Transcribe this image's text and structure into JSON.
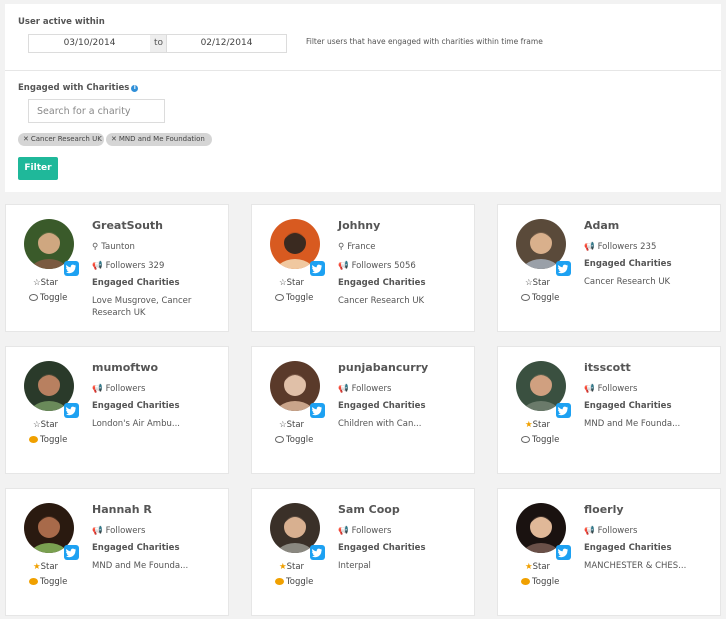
{
  "filters": {
    "active_label": "User active within",
    "date_from": "03/10/2014",
    "to_label": "to",
    "date_to": "02/12/2014",
    "help_text": "Filter users that have engaged with charities within time frame",
    "charities_label": "Engaged with Charities",
    "search_placeholder": "Search for a charity",
    "tags": [
      "Cancer Research UK",
      "MND and Me Foundation"
    ],
    "filter_button": "Filter"
  },
  "labels": {
    "star": "Star",
    "toggle": "Toggle",
    "followers": "Followers",
    "engaged": "Engaged Charities"
  },
  "users": [
    {
      "name": "GreatSouth",
      "location": "Taunton",
      "followers": "329",
      "charities": [
        "Love Musgrove, Cancer",
        "Research UK"
      ],
      "starred": false,
      "toggled": false
    },
    {
      "name": "Johhny",
      "location": "France",
      "followers": "5056",
      "charities": [
        "Cancer Research UK"
      ],
      "starred": false,
      "toggled": false
    },
    {
      "name": "Adam",
      "location": "",
      "followers": "235",
      "charities": [
        "Cancer Research UK"
      ],
      "starred": false,
      "toggled": false
    },
    {
      "name": "mumoftwo",
      "location": "",
      "followers": "",
      "charities": [
        "London's Air Ambu..."
      ],
      "starred": false,
      "toggled": true
    },
    {
      "name": "punjabancurry",
      "location": "",
      "followers": "",
      "charities": [
        "Children with Can..."
      ],
      "starred": false,
      "toggled": false
    },
    {
      "name": "itsscott",
      "location": "",
      "followers": "",
      "charities": [
        "MND and Me Founda..."
      ],
      "starred": true,
      "toggled": false
    },
    {
      "name": "Hannah R",
      "location": "",
      "followers": "",
      "charities": [
        "MND and Me Founda..."
      ],
      "starred": true,
      "toggled": true
    },
    {
      "name": "Sam Coop",
      "location": "",
      "followers": "",
      "charities": [
        "Interpal"
      ],
      "starred": true,
      "toggled": true
    },
    {
      "name": "floerly",
      "location": "",
      "followers": "",
      "charities": [
        "MANCHESTER & CHES..."
      ],
      "starred": true,
      "toggled": true
    }
  ],
  "colors": {
    "accent": "#1fb89a",
    "twitter": "#1da1f2",
    "star_active": "#f0a000"
  },
  "icons": {
    "location": "map-marker-icon",
    "followers": "bullhorn-icon",
    "star": "star-icon",
    "toggle": "comment-icon",
    "badge": "twitter-icon",
    "info": "info-icon",
    "remove": "close-icon"
  }
}
